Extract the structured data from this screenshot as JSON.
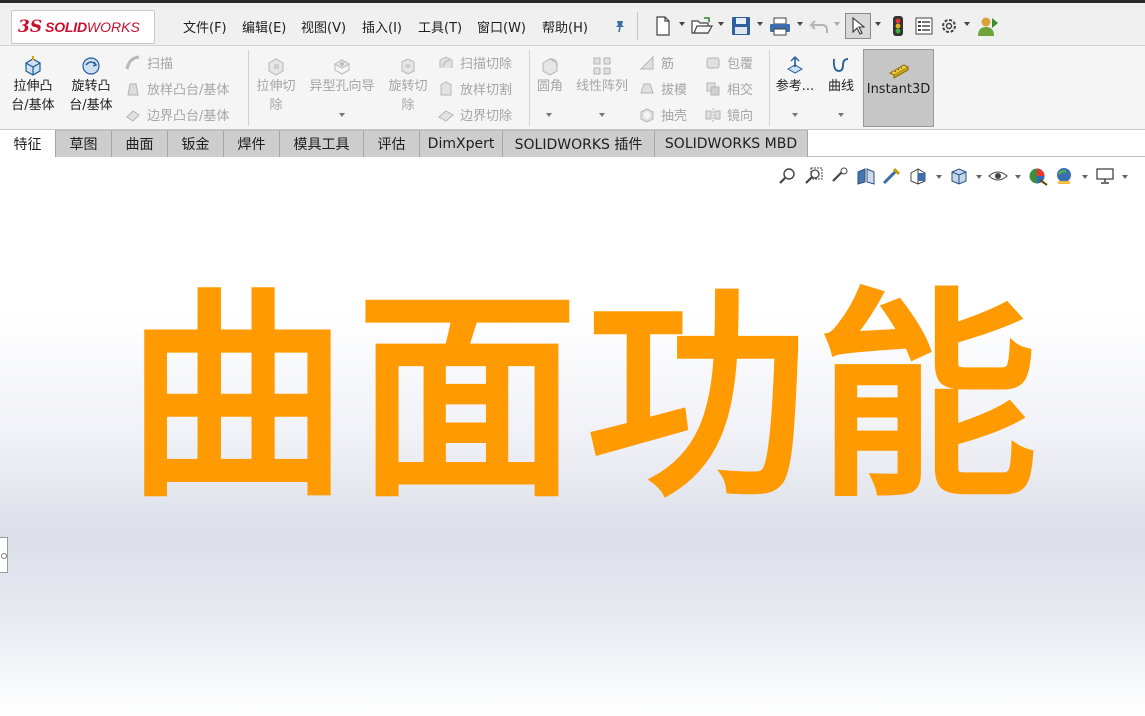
{
  "app": {
    "logo_ds": "3S",
    "logo_solid": "SOLID",
    "logo_works": "WORKS"
  },
  "menu": [
    {
      "label": "文件(F)"
    },
    {
      "label": "编辑(E)"
    },
    {
      "label": "视图(V)"
    },
    {
      "label": "插入(I)"
    },
    {
      "label": "工具(T)"
    },
    {
      "label": "窗口(W)"
    },
    {
      "label": "帮助(H)"
    }
  ],
  "quick_access_icons": [
    "pin-icon",
    "new-document-icon",
    "open-file-icon",
    "save-icon",
    "print-icon",
    "undo-icon",
    "select-pointer-icon",
    "rebuild-traffic-light-icon",
    "file-properties-icon",
    "options-gear-icon",
    "user-login-icon"
  ],
  "ribbon": {
    "extrude_boss": {
      "line1": "拉伸凸",
      "line2": "台/基体"
    },
    "revolve_boss": {
      "line1": "旋转凸",
      "line2": "台/基体"
    },
    "sweep": "扫描",
    "loft_boss": "放样凸台/基体",
    "boundary_boss": "边界凸台/基体",
    "extrude_cut": {
      "line1": "拉伸切",
      "line2": "除"
    },
    "hole_wizard": "异型孔向导",
    "revolve_cut": {
      "line1": "旋转切",
      "line2": "除"
    },
    "swept_cut": "扫描切除",
    "lofted_cut": "放样切割",
    "boundary_cut": "边界切除",
    "fillet": "圆角",
    "linear_pattern": "线性阵列",
    "rib": "筋",
    "draft": "拔模",
    "shell": "抽壳",
    "wrap": "包覆",
    "intersect": "相交",
    "mirror": "镜向",
    "reference": "参考...",
    "curves": "曲线",
    "instant3d": "Instant3D"
  },
  "tabs": [
    {
      "label": "特征",
      "active": true
    },
    {
      "label": "草图",
      "active": false
    },
    {
      "label": "曲面",
      "active": false
    },
    {
      "label": "钣金",
      "active": false
    },
    {
      "label": "焊件",
      "active": false
    },
    {
      "label": "模具工具",
      "active": false
    },
    {
      "label": "评估",
      "active": false
    },
    {
      "label": "DimXpert",
      "active": false
    },
    {
      "label": "SOLIDWORKS 插件",
      "active": false
    },
    {
      "label": "SOLIDWORKS MBD",
      "active": false
    }
  ],
  "headsup_icons": [
    "zoom-to-fit-icon",
    "zoom-to-area-icon",
    "previous-view-icon",
    "section-view-icon",
    "dynamic-annotation-icon",
    "view-orientation-icon",
    "display-style-icon",
    "hide-show-items-icon",
    "edit-appearance-icon",
    "apply-scene-icon",
    "view-settings-icon"
  ],
  "graphics": {
    "title_chars": [
      "曲",
      "面",
      "功",
      "能"
    ],
    "title_color": "#ff9a00"
  },
  "colors": {
    "brand_red": "#c8102e",
    "active_tab": "#ffffff",
    "inactive_tab": "#cdcdcd",
    "instant3d_active": "#c6c6c6"
  }
}
